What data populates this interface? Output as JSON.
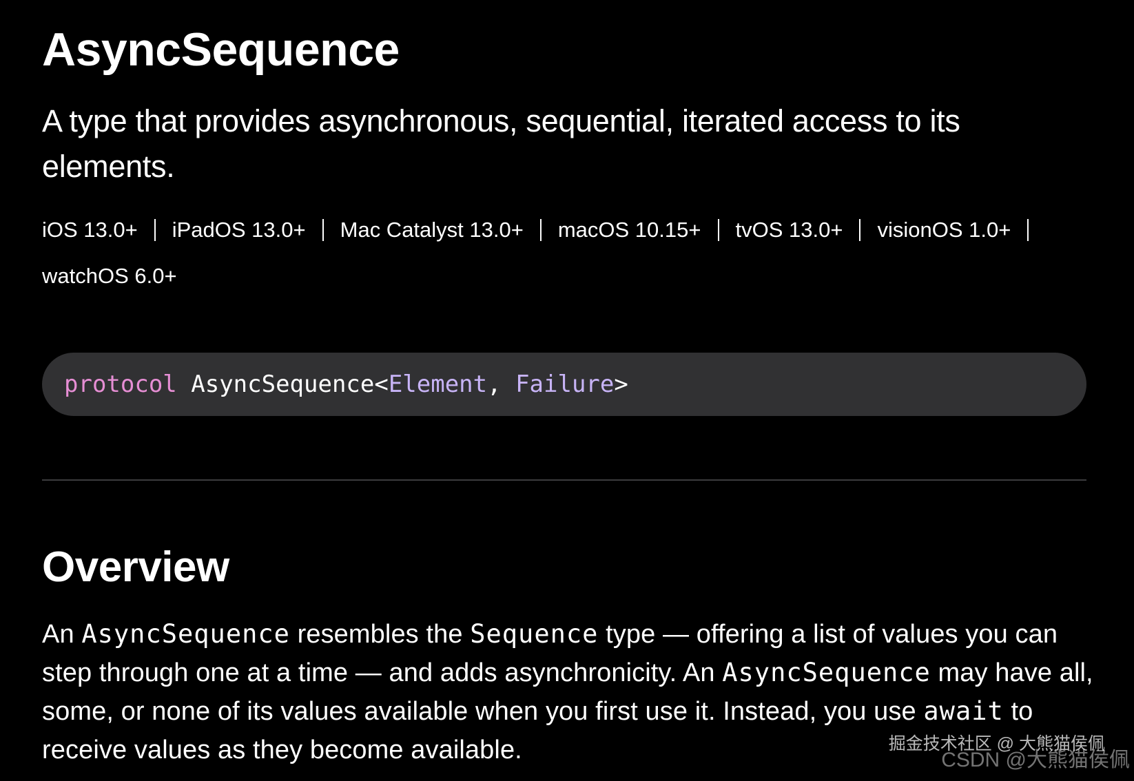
{
  "title": "AsyncSequence",
  "abstract": "A type that provides asynchronous, sequential, iterated access to its elements.",
  "platforms": [
    "iOS 13.0+",
    "iPadOS 13.0+",
    "Mac Catalyst 13.0+",
    "macOS 10.15+",
    "tvOS 13.0+",
    "visionOS 1.0+",
    "watchOS 6.0+"
  ],
  "declaration": {
    "keyword": "protocol",
    "name": "AsyncSequence<",
    "param1": "Element",
    "comma": ", ",
    "param2": "Failure",
    "close": ">"
  },
  "overview": {
    "heading": "Overview",
    "t1": "An ",
    "c1": "AsyncSequence",
    "t2": " resembles the ",
    "c2": "Sequence",
    "t3": " type — offering a list of values you can step through one at a time — and adds asynchronicity. An ",
    "c3": "AsyncSequence",
    "t4": " may have all, some, or none of its values available when you first use it. Instead, you use ",
    "c4": "await",
    "t5": " to receive values as they become available."
  },
  "watermark": {
    "line1": "掘金技术社区 @ 大熊猫侯佩",
    "line2": "CSDN @大熊猫侯佩"
  },
  "colors": {
    "background": "#000000",
    "code_background": "#313133",
    "keyword": "#e68ed4",
    "type_param": "#c8b4f7",
    "divider": "#3c3c3e"
  }
}
